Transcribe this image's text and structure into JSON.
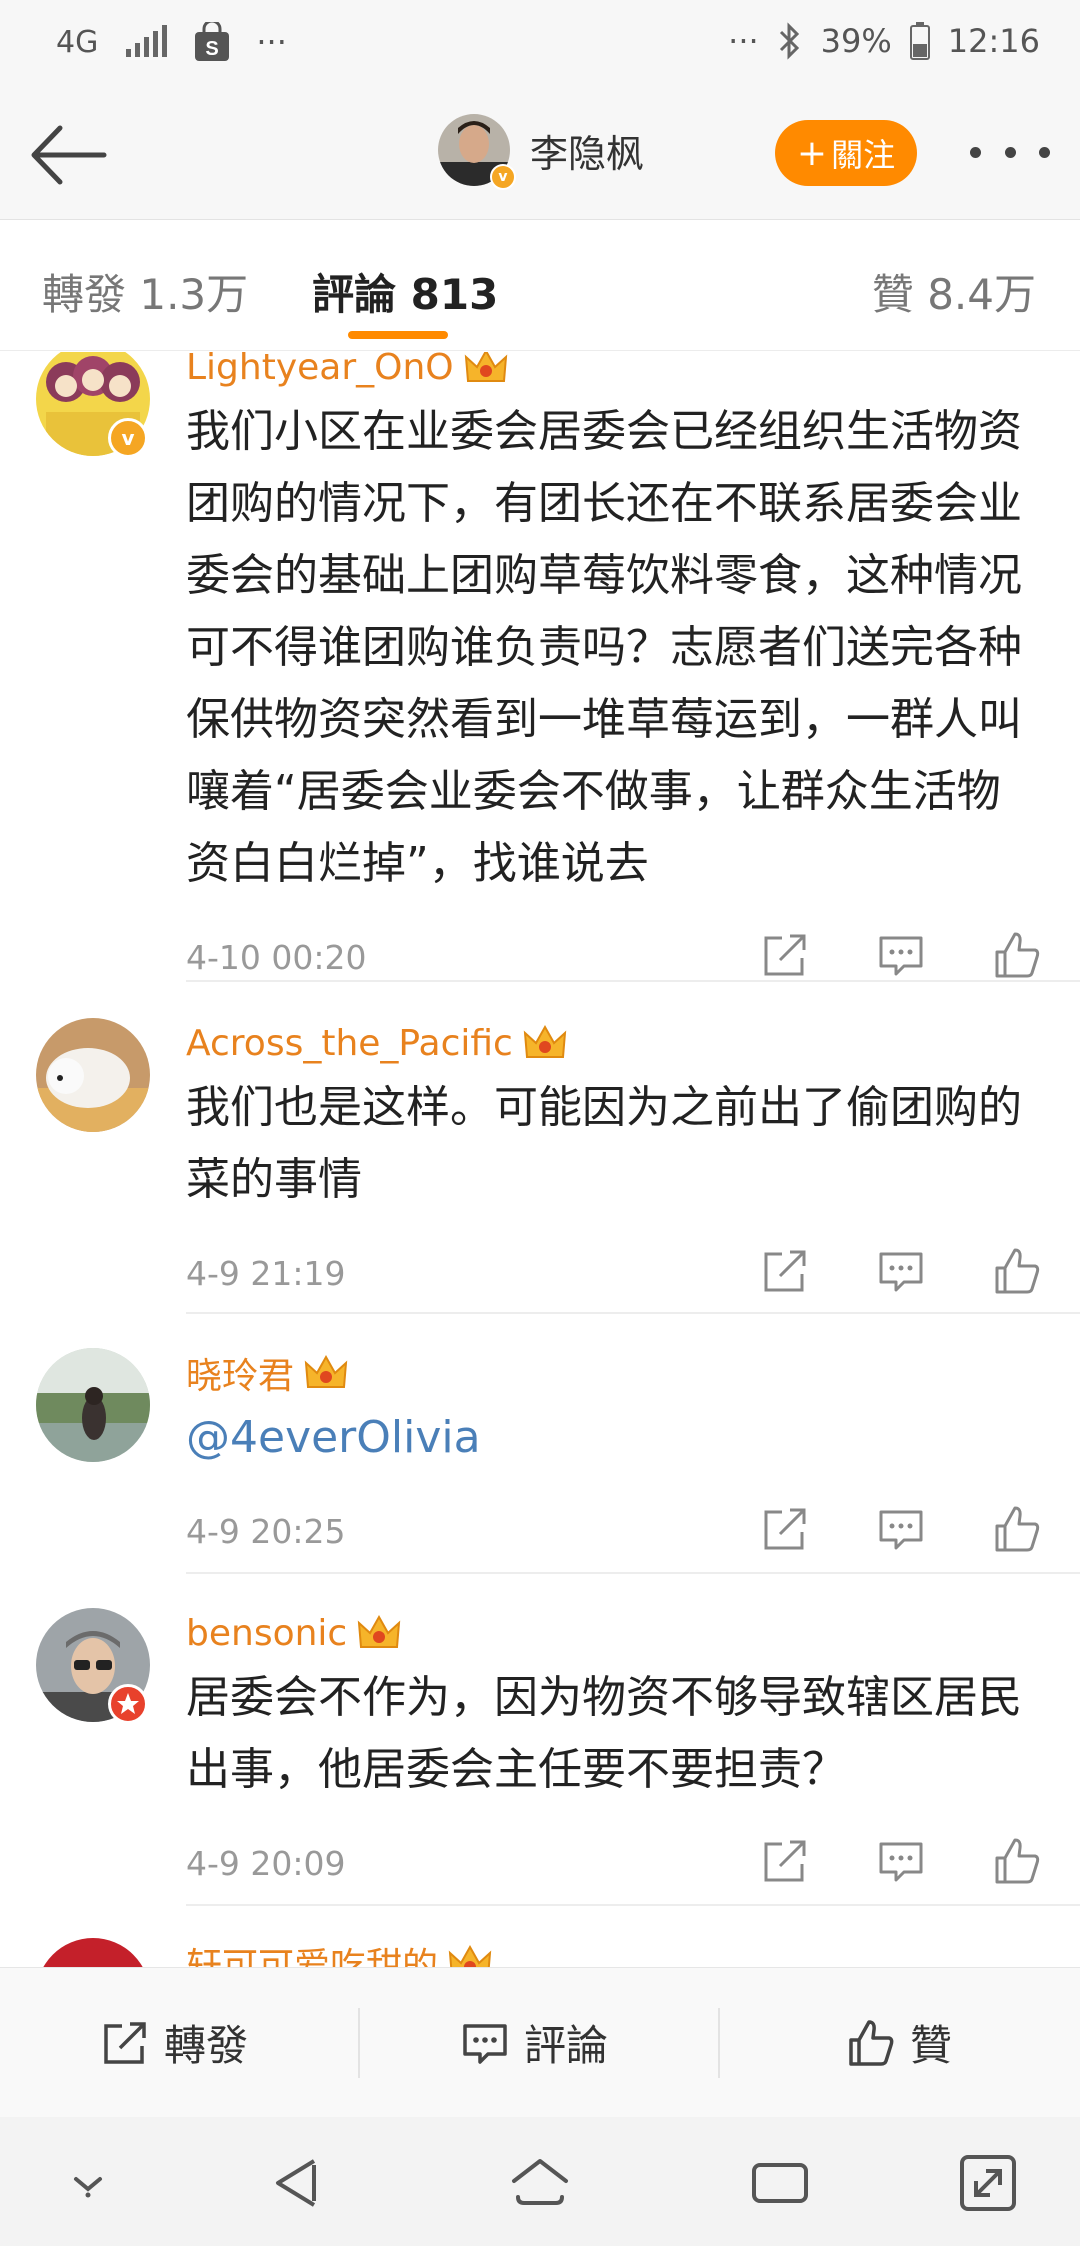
{
  "status_bar": {
    "network": "4G",
    "time": "12:16",
    "battery": "39%",
    "more": "···"
  },
  "header": {
    "profile_name": "李隐枫",
    "follow_label": "關注",
    "follow_plus": "+"
  },
  "tabs": {
    "repost": "轉發 1.3万",
    "comments": "評論 813",
    "likes": "贊 8.4万",
    "active": "comments"
  },
  "comments": [
    {
      "user": "Lightyear_OnO",
      "text": "我们小区在业委会居委会已经组织生活物资团购的情况下，有团长还在不联系居委会业委会的基础上团购草莓饮料零食，这种情况可不得谁团购谁负责吗？志愿者们送完各种保供物资突然看到一堆草莓运到，一群人叫嚷着“居委会业委会不做事，让群众生活物资白白烂掉”，找谁说去",
      "time": "4-10 00:20",
      "badge": "verified"
    },
    {
      "user": "Across_the_Pacific",
      "text": "我们也是这样。可能因为之前出了偷团购的菜的事情",
      "time": "4-9 21:19",
      "badge": "none"
    },
    {
      "user": "晓玲君",
      "text": "@4everOlivia",
      "time": "4-9 20:25",
      "badge": "none"
    },
    {
      "user": "bensonic",
      "text": "居委会不作为，因为物资不够导致辖区居民出事，他居委会主任要不要担责？",
      "time": "4-9 20:09",
      "badge": "red"
    },
    {
      "user": "轩可可爱吃甜的",
      "text": "",
      "time": "",
      "badge": "none"
    }
  ],
  "bottom_bar": {
    "repost": "轉發",
    "comment": "評論",
    "like": "贊"
  },
  "colors": {
    "accent": "#ff8a00",
    "username": "#e8821e",
    "mention": "#4a7fb8"
  }
}
